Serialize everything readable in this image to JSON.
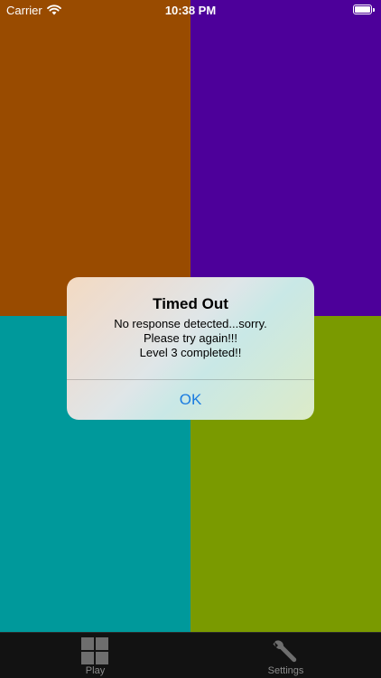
{
  "colors": {
    "top_left": "#994b00",
    "top_right": "#4d009a",
    "bottom_left": "#00999b",
    "bottom_right": "#7a9a00",
    "tab_bar": "#121212",
    "ok_button": "#1a7be0"
  },
  "status_bar": {
    "carrier": "Carrier",
    "time": "10:38 PM"
  },
  "alert": {
    "title": "Timed Out",
    "message": "No response detected...sorry.\nPlease try again!!!\nLevel 3 completed!!",
    "ok_label": "OK"
  },
  "tab_bar": {
    "items": [
      {
        "label": "Play",
        "icon": "grid-icon"
      },
      {
        "label": "Settings",
        "icon": "wrench-icon"
      }
    ]
  }
}
